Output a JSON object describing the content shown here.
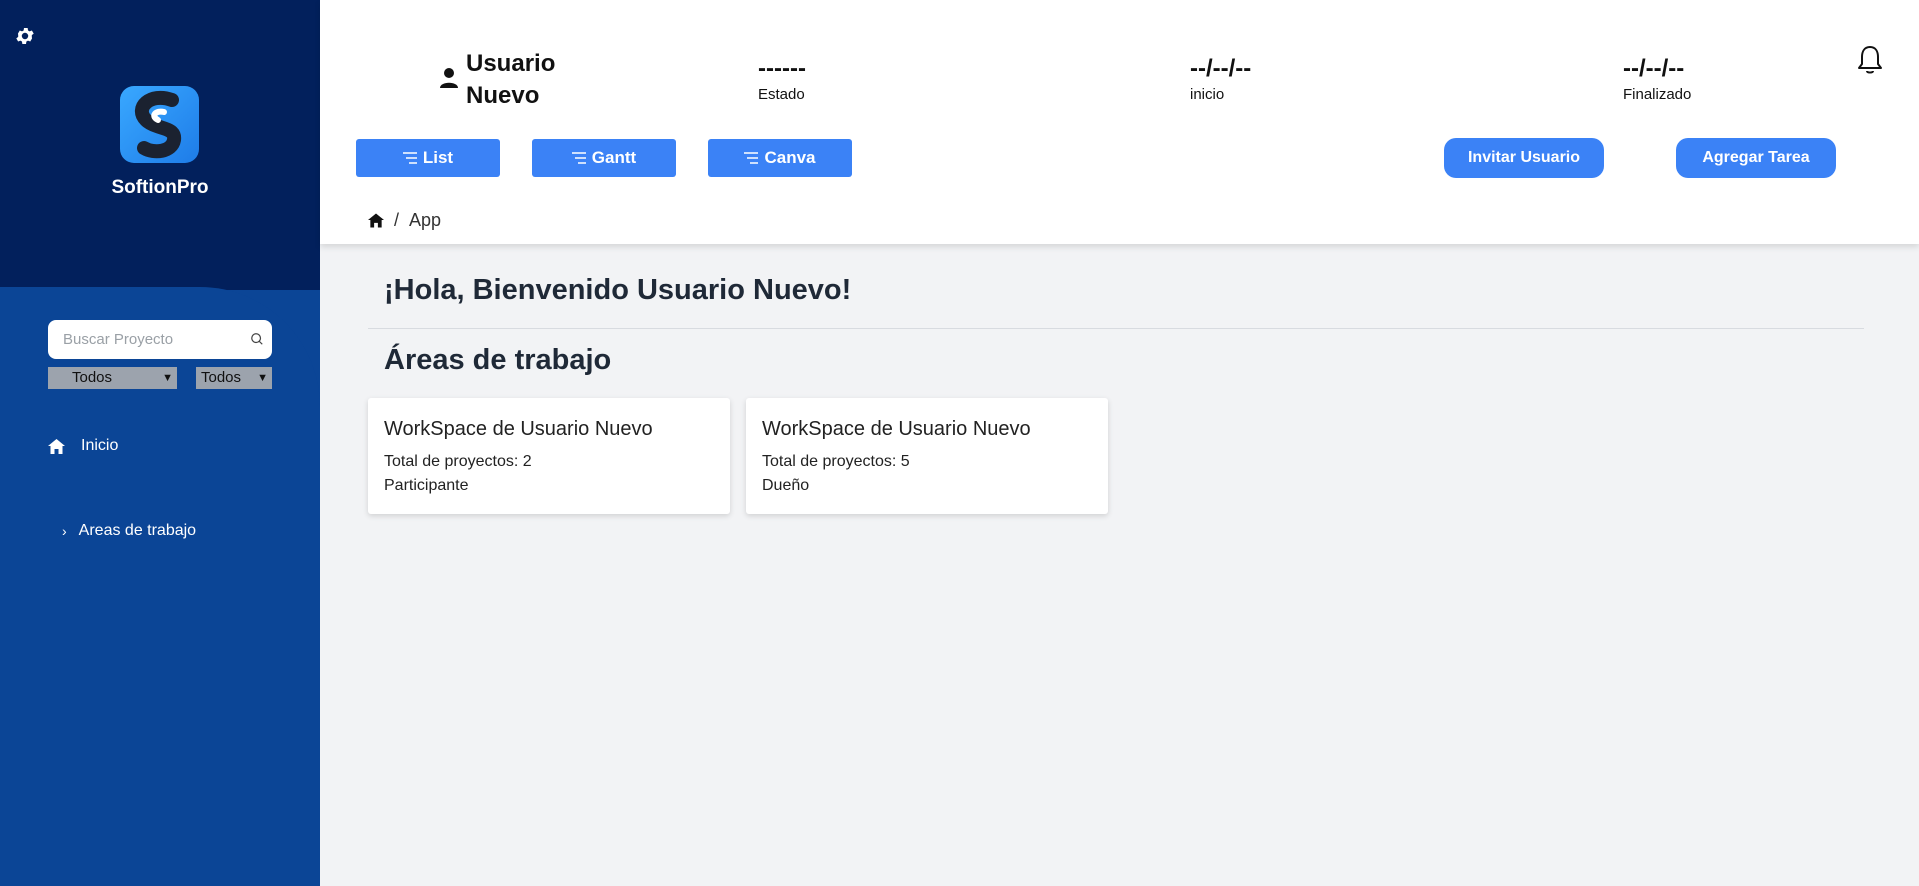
{
  "sidebar": {
    "brand": "SoftionPro",
    "search_placeholder": "Buscar Proyecto",
    "filter1": "Todos",
    "filter2": "Todos",
    "nav_inicio": "Inicio",
    "nav_areas": "Areas de trabajo"
  },
  "header": {
    "user_name": "Usuario Nuevo",
    "estado_value": "------",
    "estado_label": "Estado",
    "inicio_value": "--/--/--",
    "inicio_label": "inicio",
    "final_value": "--/--/--",
    "final_label": "Finalizado",
    "btn_list": "List",
    "btn_gantt": "Gantt",
    "btn_canva": "Canva",
    "btn_invite": "Invitar Usuario",
    "btn_add": "Agregar Tarea",
    "breadcrumb_sep": "/",
    "breadcrumb_page": "App"
  },
  "main": {
    "greeting": "¡Hola, Bienvenido Usuario Nuevo!",
    "areas_title": "Áreas de trabajo",
    "cards": [
      {
        "title": "WorkSpace de Usuario Nuevo",
        "projects": "Total de proyectos: 2",
        "role": "Participante"
      },
      {
        "title": "WorkSpace de Usuario Nuevo",
        "projects": "Total de proyectos: 5",
        "role": "Dueño"
      }
    ]
  },
  "colors": {
    "sidebar_top": "#02205c",
    "sidebar": "#0b4596",
    "accent": "#3b82f6",
    "bg": "#f2f3f5"
  }
}
